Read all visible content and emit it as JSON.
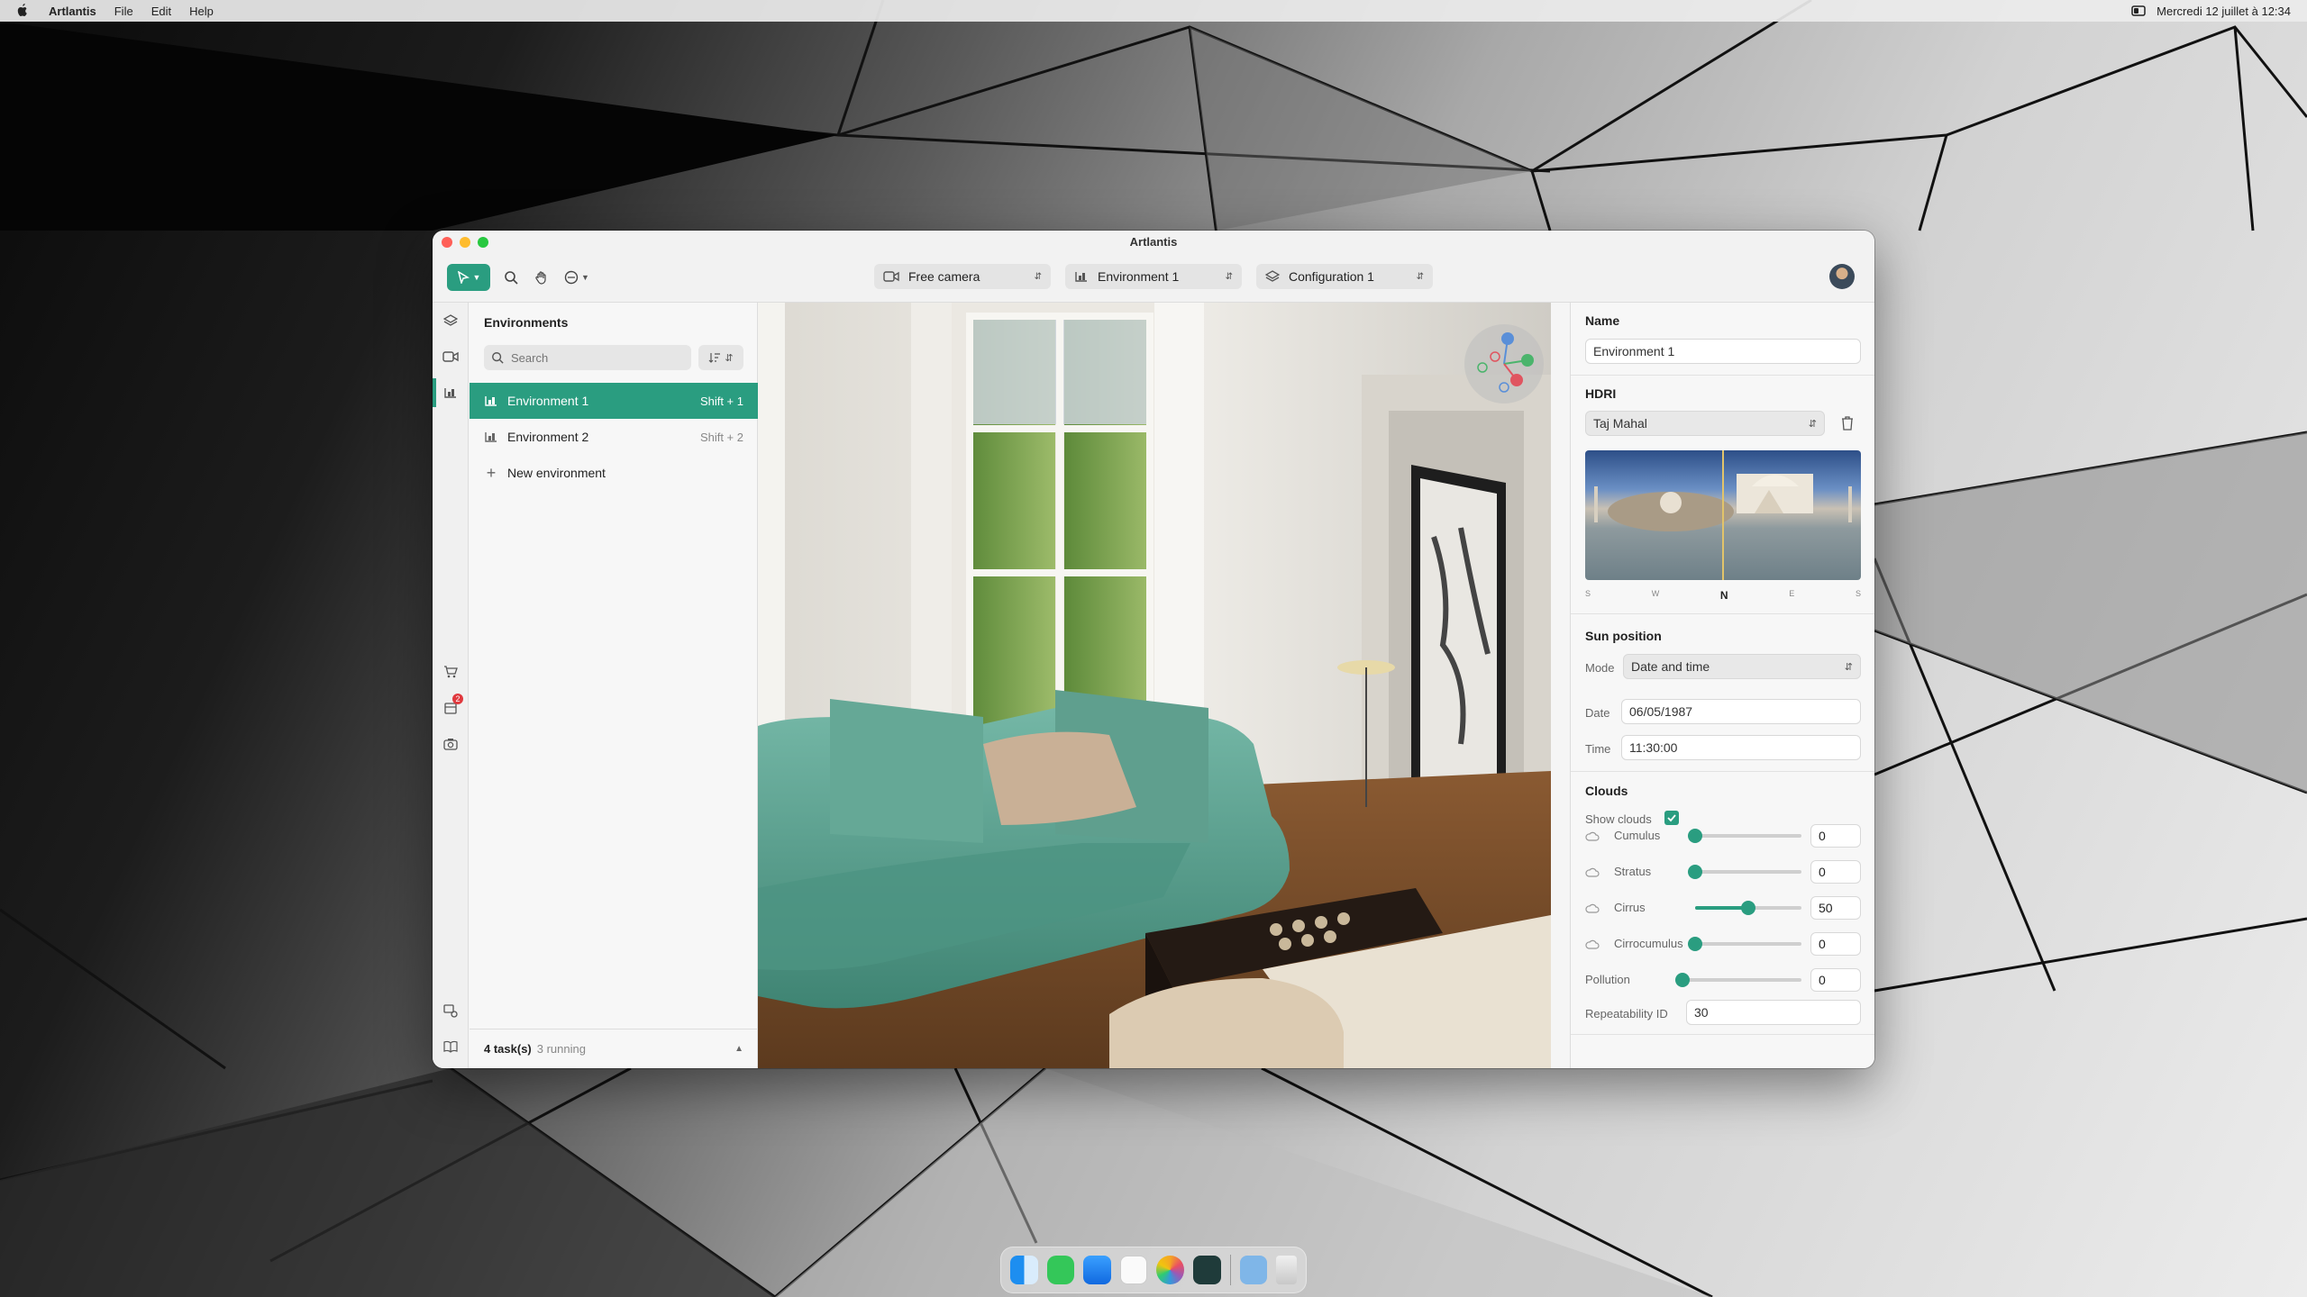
{
  "menubar": {
    "app": "Artlantis",
    "items": [
      "File",
      "Edit",
      "Help"
    ],
    "datetime": "Mercredi 12 juillet à 12:34"
  },
  "window": {
    "title": "Artlantis"
  },
  "toolbar": {
    "camera": "Free camera",
    "environment": "Environment 1",
    "configuration": "Configuration 1"
  },
  "env_panel": {
    "title": "Environments",
    "search_placeholder": "Search",
    "items": [
      {
        "label": "Environment 1",
        "shortcut": "Shift + 1"
      },
      {
        "label": "Environment 2",
        "shortcut": "Shift + 2"
      }
    ],
    "new_label": "New environment",
    "tasks": "4 task(s)",
    "running": "3 running"
  },
  "rail": {
    "badge": "2"
  },
  "props": {
    "name_title": "Name",
    "name_value": "Environment 1",
    "hdri_title": "HDRI",
    "hdri_value": "Taj Mahal",
    "compass": [
      "S",
      "W",
      "N",
      "E",
      "S"
    ],
    "sun_title": "Sun position",
    "mode_label": "Mode",
    "mode_value": "Date and time",
    "date_label": "Date",
    "date_value": "06/05/1987",
    "time_label": "Time",
    "time_value": "11:30:00",
    "clouds_title": "Clouds",
    "show_clouds_label": "Show clouds",
    "show_clouds": true,
    "sliders": [
      {
        "label": "Cumulus",
        "value": "0",
        "fraction": 0,
        "icon": "cloud-icon"
      },
      {
        "label": "Stratus",
        "value": "0",
        "fraction": 0,
        "icon": "stratus-icon"
      },
      {
        "label": "Cirrus",
        "value": "50",
        "fraction": 0.5,
        "icon": "cirrus-icon"
      },
      {
        "label": "Cirrocumulus",
        "value": "0",
        "fraction": 0,
        "icon": "cirrocumulus-icon"
      },
      {
        "label": "Pollution",
        "value": "0",
        "fraction": 0,
        "icon": ""
      }
    ],
    "repeat_label": "Repeatability ID",
    "repeat_value": "30"
  },
  "colors": {
    "accent": "#2a9d80"
  }
}
